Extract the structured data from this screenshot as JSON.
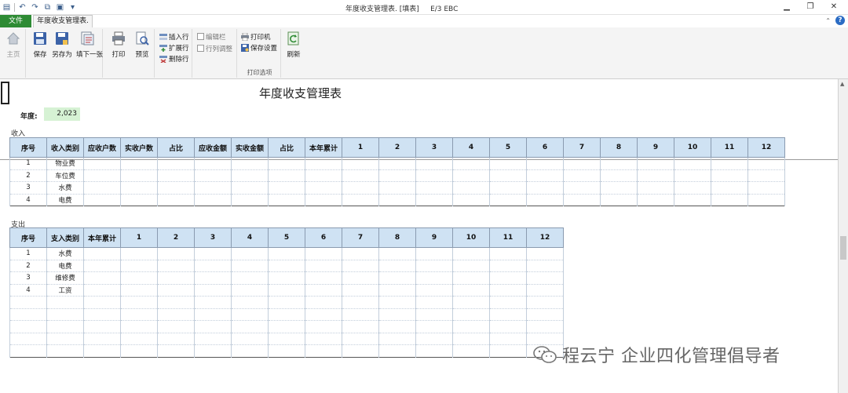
{
  "window": {
    "title": "年度收支管理表. [填表]",
    "subtitle": "E/3 EBC"
  },
  "tabs": {
    "file": "文件",
    "active": "年度收支管理表."
  },
  "ribbon": {
    "home": "主页",
    "save": "保存",
    "save_as": "另存为",
    "fill_next": "填下一张",
    "print": "打印",
    "preview": "预览",
    "insert_row": "插入行",
    "expand_row": "扩展行",
    "delete_row": "删除行",
    "edit_bar": "编辑栏",
    "row_col_adjust": "行列调整",
    "printer": "打印机",
    "save_settings": "保存设置",
    "print_options": "打印选项",
    "refresh": "刷新"
  },
  "document": {
    "title": "年度收支管理表",
    "year_label": "年度:",
    "year_value": "2,023"
  },
  "income": {
    "label": "收入",
    "headers": [
      "序号",
      "收入类别",
      "应收户数",
      "实收户数",
      "占比",
      "应收金额",
      "实收金额",
      "占比",
      "本年累计",
      "1",
      "2",
      "3",
      "4",
      "5",
      "6",
      "7",
      "8",
      "9",
      "10",
      "11",
      "12"
    ],
    "rows": [
      [
        "1",
        "物业费"
      ],
      [
        "2",
        "车位费"
      ],
      [
        "3",
        "水费"
      ],
      [
        "4",
        "电费"
      ]
    ]
  },
  "expense": {
    "label": "支出",
    "headers": [
      "序号",
      "支入类别",
      "本年累计",
      "1",
      "2",
      "3",
      "4",
      "5",
      "6",
      "7",
      "8",
      "9",
      "10",
      "11",
      "12"
    ],
    "rows": [
      [
        "1",
        "水费"
      ],
      [
        "2",
        "电费"
      ],
      [
        "3",
        "维修费"
      ],
      [
        "4",
        "工资"
      ],
      [
        "",
        ""
      ],
      [
        "",
        ""
      ],
      [
        "",
        ""
      ],
      [
        "",
        ""
      ],
      [
        "",
        ""
      ]
    ]
  },
  "watermark": {
    "text": "程云宁 企业四化管理倡导者"
  },
  "colors": {
    "file_tab": "#2e8b34",
    "header_fill": "#cfe2f3",
    "year_fill": "#d6f2d4"
  }
}
